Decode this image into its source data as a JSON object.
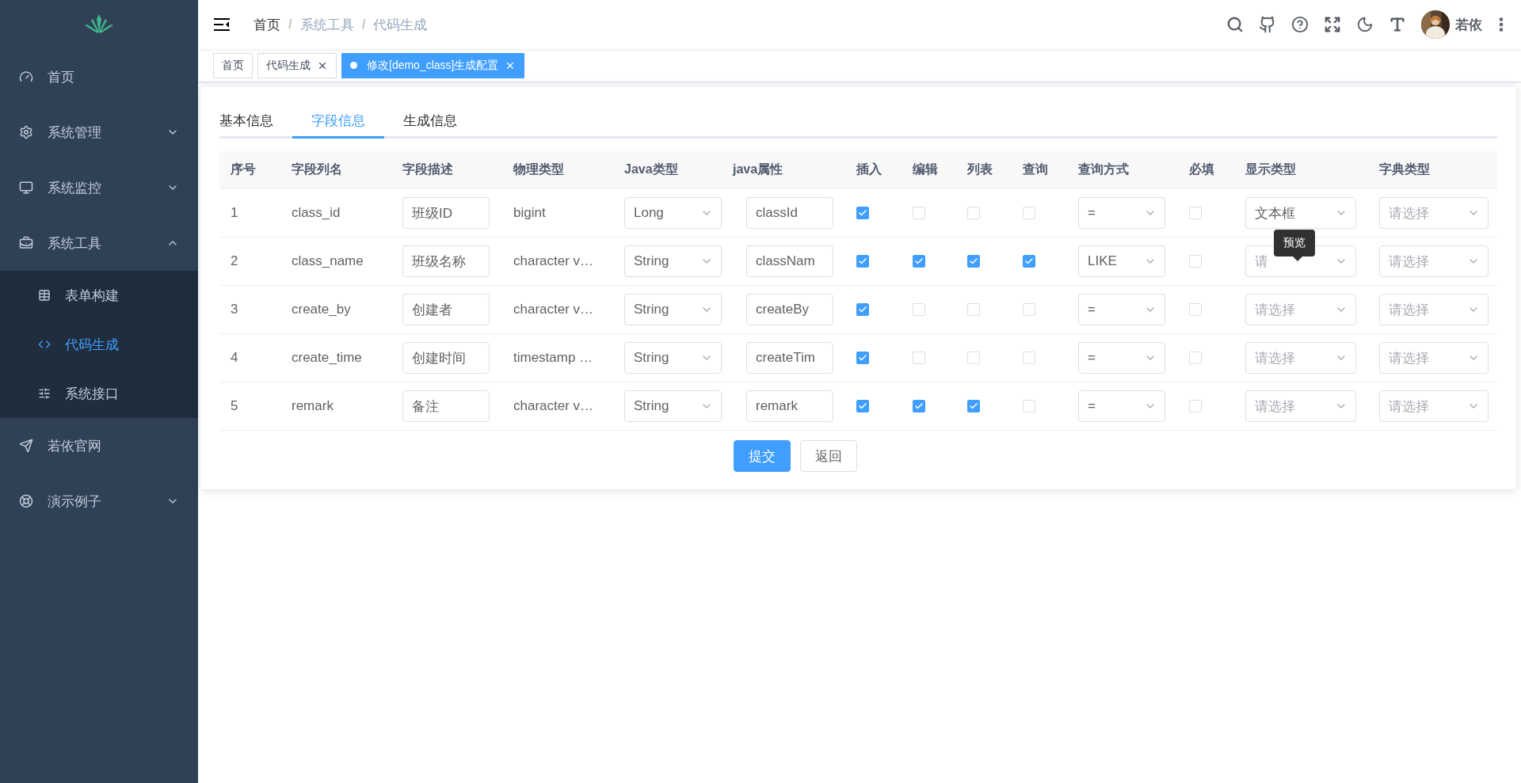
{
  "sidebar": {
    "items": [
      {
        "label": "首页",
        "expandable": false,
        "selected": false
      },
      {
        "label": "系统管理",
        "expandable": true,
        "expanded": false,
        "selected": false
      },
      {
        "label": "系统监控",
        "expandable": true,
        "expanded": false,
        "selected": false
      },
      {
        "label": "系统工具",
        "expandable": true,
        "expanded": true,
        "selected": false,
        "children": [
          {
            "label": "表单构建",
            "selected": false
          },
          {
            "label": "代码生成",
            "selected": true
          },
          {
            "label": "系统接口",
            "selected": false
          }
        ]
      },
      {
        "label": "若依官网",
        "expandable": false,
        "selected": false
      },
      {
        "label": "演示例子",
        "expandable": true,
        "expanded": false,
        "selected": false
      }
    ]
  },
  "breadcrumb": {
    "separator": "/",
    "items": [
      "首页",
      "系统工具",
      "代码生成"
    ]
  },
  "header": {
    "user_name": "若依"
  },
  "tags": [
    {
      "label": "首页",
      "closable": false,
      "selected": false
    },
    {
      "label": "代码生成",
      "closable": true,
      "selected": false
    },
    {
      "label": "修改[demo_class]生成配置",
      "closable": true,
      "selected": true
    }
  ],
  "form_tabs": [
    {
      "label": "基本信息",
      "selected": false
    },
    {
      "label": "字段信息",
      "selected": true
    },
    {
      "label": "生成信息",
      "selected": false
    }
  ],
  "table": {
    "columns": [
      "序号",
      "字段列名",
      "字段描述",
      "物理类型",
      "Java类型",
      "java属性",
      "插入",
      "编辑",
      "列表",
      "查询",
      "查询方式",
      "必填",
      "显示类型",
      "字典类型"
    ],
    "rows": [
      {
        "index": "1",
        "column_name": "class_id",
        "description": "班级ID",
        "physical_type": "bigint",
        "java_type": "Long",
        "java_field": "classId",
        "insert": true,
        "edit": false,
        "list": false,
        "query": false,
        "query_type": "=",
        "required": false,
        "html_type": {
          "value": "文本框"
        },
        "dict_type": {
          "placeholder": "请选择"
        }
      },
      {
        "index": "2",
        "column_name": "class_name",
        "description": "班级名称",
        "physical_type": "character v…",
        "java_type": "String",
        "java_field": "classNam",
        "insert": true,
        "edit": true,
        "list": true,
        "query": true,
        "query_type": "LIKE",
        "required": false,
        "html_type": {
          "placeholder": "请",
          "tooltip": "预览"
        },
        "dict_type": {
          "placeholder": "请选择"
        }
      },
      {
        "index": "3",
        "column_name": "create_by",
        "description": "创建者",
        "physical_type": "character v…",
        "java_type": "String",
        "java_field": "createBy",
        "insert": true,
        "edit": false,
        "list": false,
        "query": false,
        "query_type": "=",
        "required": false,
        "html_type": {
          "placeholder": "请选择"
        },
        "dict_type": {
          "placeholder": "请选择"
        }
      },
      {
        "index": "4",
        "column_name": "create_time",
        "description": "创建时间",
        "physical_type": "timestamp …",
        "java_type": "String",
        "java_field": "createTim",
        "insert": true,
        "edit": false,
        "list": false,
        "query": false,
        "query_type": "=",
        "required": false,
        "html_type": {
          "placeholder": "请选择"
        },
        "dict_type": {
          "placeholder": "请选择"
        }
      },
      {
        "index": "5",
        "column_name": "remark",
        "description": "备注",
        "physical_type": "character v…",
        "java_type": "String",
        "java_field": "remark",
        "insert": true,
        "edit": true,
        "list": true,
        "query": false,
        "query_type": "=",
        "required": false,
        "html_type": {
          "placeholder": "请选择"
        },
        "dict_type": {
          "placeholder": "请选择"
        }
      }
    ]
  },
  "buttons": [
    {
      "label": "提交",
      "kind": "primary"
    },
    {
      "label": "返回",
      "kind": "default"
    }
  ]
}
